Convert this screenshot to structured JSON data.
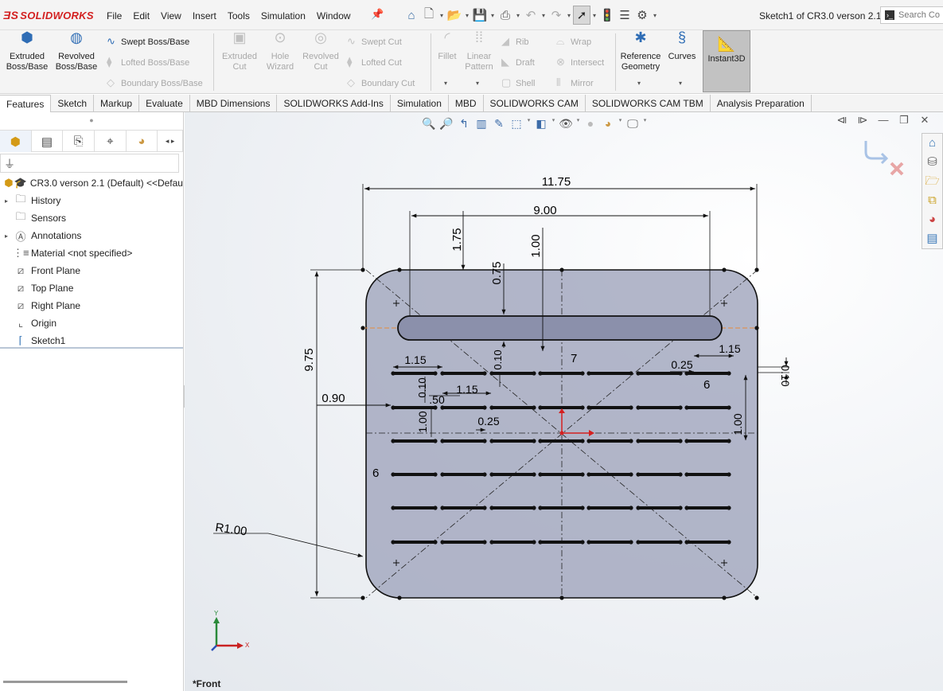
{
  "app": {
    "logo": "SOLIDWORKS",
    "menu": [
      "File",
      "Edit",
      "View",
      "Insert",
      "Tools",
      "Simulation",
      "Window"
    ],
    "document_title": "Sketch1 of CR3.0 verson 2.1",
    "search_placeholder": "Search Co"
  },
  "command_manager": {
    "extruded_boss": "Extruded Boss/Base",
    "revolved_boss": "Revolved Boss/Base",
    "swept_boss": "Swept Boss/Base",
    "lofted_boss": "Lofted Boss/Base",
    "boundary_boss": "Boundary Boss/Base",
    "extruded_cut": "Extruded Cut",
    "hole_wizard": "Hole Wizard",
    "revolved_cut": "Revolved Cut",
    "swept_cut": "Swept Cut",
    "lofted_cut": "Lofted Cut",
    "boundary_cut": "Boundary Cut",
    "fillet": "Fillet",
    "linear_pattern": "Linear Pattern",
    "rib": "Rib",
    "draft": "Draft",
    "shell": "Shell",
    "wrap": "Wrap",
    "intersect": "Intersect",
    "mirror": "Mirror",
    "reference_geometry": "Reference Geometry",
    "curves": "Curves",
    "instant3d": "Instant3D"
  },
  "tabs": [
    "Features",
    "Sketch",
    "Markup",
    "Evaluate",
    "MBD Dimensions",
    "SOLIDWORKS Add-Ins",
    "Simulation",
    "MBD",
    "SOLIDWORKS CAM",
    "SOLIDWORKS CAM TBM",
    "Analysis Preparation"
  ],
  "feature_tree": {
    "root": "CR3.0 verson 2.1 (Default) <<Defau",
    "items": [
      {
        "label": "History",
        "icon": "history-folder-icon",
        "expandable": true
      },
      {
        "label": "Sensors",
        "icon": "sensors-icon",
        "expandable": false
      },
      {
        "label": "Annotations",
        "icon": "annotations-icon",
        "expandable": true
      },
      {
        "label": "Material <not specified>",
        "icon": "material-icon",
        "expandable": false
      },
      {
        "label": "Front Plane",
        "icon": "plane-icon",
        "expandable": false
      },
      {
        "label": "Top Plane",
        "icon": "plane-icon",
        "expandable": false
      },
      {
        "label": "Right Plane",
        "icon": "plane-icon",
        "expandable": false
      },
      {
        "label": "Origin",
        "icon": "origin-icon",
        "expandable": false
      },
      {
        "label": "Sketch1",
        "icon": "sketch-icon",
        "expandable": false
      }
    ]
  },
  "sketch": {
    "dims": {
      "overall_width": "11.75",
      "slot_length": "9.00",
      "slot_offset": "1.75",
      "slot_center_offset": "1.00",
      "slot_width": "0.75",
      "overall_height": "9.75",
      "left_offset": "0.90",
      "fillet_radius": "R1.00",
      "slot_len_left": "1.15",
      "slot_len_right": "1.15",
      "slot_spacing": "1.15",
      "slot_width_a": "0.10",
      "slot_width_b": "0.10",
      "slot_width_c": "0.10",
      "col_gap_a": "0.25",
      "col_gap_b": "0.25",
      "gap_50": ".50",
      "row_pitch_left": "1.00",
      "row_pitch_right": "1.00",
      "count_cols": "7",
      "count_rows_right": "6",
      "count_rows_left": "6"
    },
    "colors": {
      "fill": "#a5a9c0",
      "line": "#111111",
      "construction": "#e58a3c",
      "origin": "#d42020"
    }
  },
  "view": {
    "label": "*Front",
    "axis_y": "Y",
    "axis_x": "X"
  }
}
